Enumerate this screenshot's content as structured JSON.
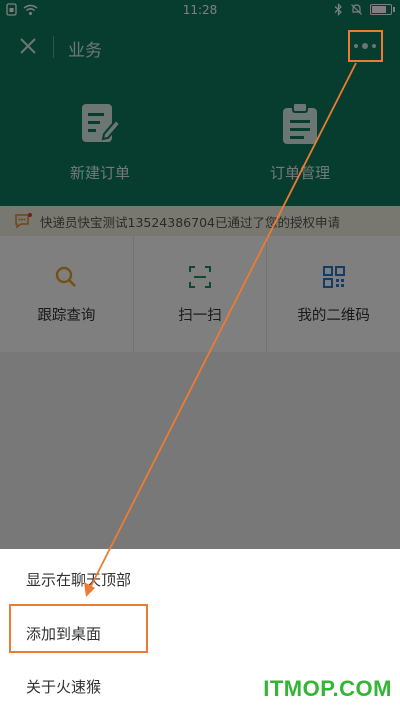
{
  "status_bar": {
    "time": "11:28"
  },
  "header": {
    "title": "业务"
  },
  "hero": {
    "items": [
      {
        "label": "新建订单",
        "icon": "edit-document-icon"
      },
      {
        "label": "订单管理",
        "icon": "clipboard-icon"
      }
    ]
  },
  "notice": {
    "text": "快递员快宝测试13524386704已通过了您的授权申请",
    "icon": "message-icon"
  },
  "grid": {
    "items": [
      {
        "label": "跟踪查询",
        "icon": "search-icon"
      },
      {
        "label": "扫一扫",
        "icon": "scan-icon"
      },
      {
        "label": "我的二维码",
        "icon": "qr-code-icon"
      }
    ]
  },
  "menu": {
    "items": [
      {
        "label": "显示在聊天顶部"
      },
      {
        "label": "添加到桌面"
      },
      {
        "label": "关于火速猴"
      }
    ]
  },
  "watermark": "ITMOP.COM",
  "colors": {
    "brand": "#0f7a5c",
    "highlight": "#ef7b32",
    "watermark": "#33b535"
  }
}
